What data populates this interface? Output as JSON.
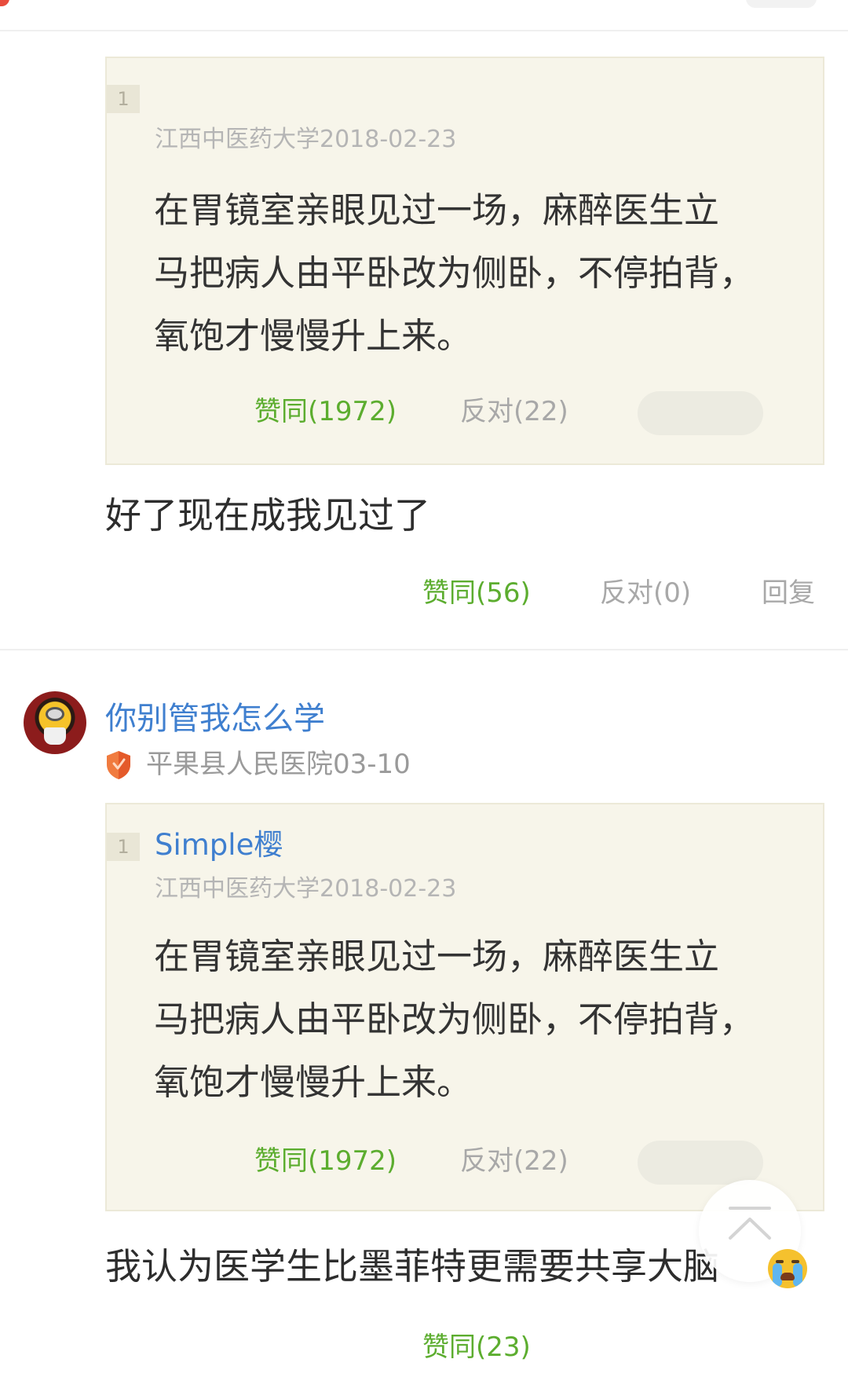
{
  "quote1": {
    "floor": "1",
    "meta": "江西中医药大学2018-02-23",
    "lines": [
      "在胃镜室亲眼见过一场，麻醉医生立",
      "马把病人由平卧改为侧卧，不停拍背，",
      "氧饱才慢慢升上来。"
    ],
    "agree": "赞同(1972)",
    "oppose": "反对(22)"
  },
  "reply1": {
    "text": "好了现在成我见过了",
    "agree": "赞同(56)",
    "oppose": "反对(0)",
    "reply": "回复"
  },
  "comment2": {
    "username": "你别管我怎么学",
    "meta": "平果县人民医院03-10",
    "quote": {
      "floor": "1",
      "user": "Simple樱",
      "meta": "江西中医药大学2018-02-23",
      "lines": [
        "在胃镜室亲眼见过一场，麻醉医生立",
        "马把病人由平卧改为侧卧，不停拍背，",
        "氧饱才慢慢升上来。"
      ],
      "agree": "赞同(1972)",
      "oppose": "反对(22)"
    },
    "text": "我认为医学生比墨菲特更需要共享大脑",
    "agree": "赞同(23)"
  },
  "icons": {
    "badge": "shield-badge-icon",
    "scroll": "scroll-to-top-icon",
    "emoji": "crying-face-emoji"
  },
  "colors": {
    "agree_green": "#5cad2f",
    "username_blue": "#3f7fcf",
    "quote_bg": "#f7f5ea",
    "muted_gray": "#a8a8a8"
  }
}
